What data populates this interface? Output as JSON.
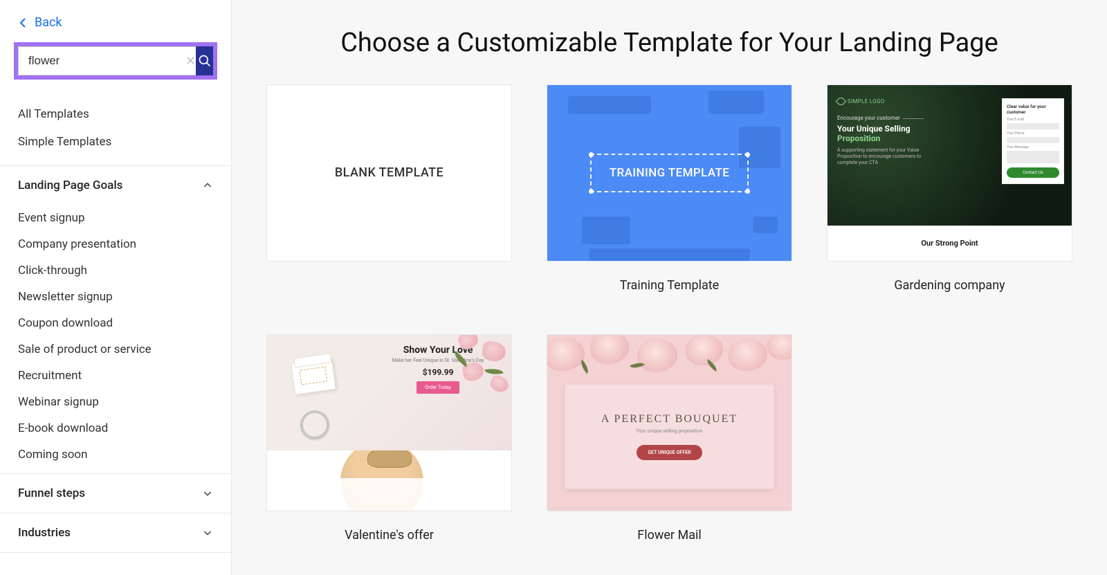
{
  "back_label": "Back",
  "search": {
    "value": "flower"
  },
  "nav": {
    "all_templates": "All Templates",
    "simple_templates": "Simple Templates"
  },
  "sections": {
    "goals": {
      "title": "Landing Page Goals",
      "items": [
        "Event signup",
        "Company presentation",
        "Click-through",
        "Newsletter signup",
        "Coupon download",
        "Sale of product or service",
        "Recruitment",
        "Webinar signup",
        "E-book download",
        "Coming soon"
      ]
    },
    "funnel": {
      "title": "Funnel steps"
    },
    "industries": {
      "title": "Industries"
    }
  },
  "page_title": "Choose a Customizable Template for Your Landing Page",
  "templates": {
    "blank": {
      "thumb_label": "BLANK TEMPLATE"
    },
    "training": {
      "thumb_label": "TRAINING TEMPLATE",
      "caption": "Training Template"
    },
    "gardening": {
      "caption": "Gardening company",
      "logo": "SIMPLE LOGO",
      "encourage": "Encourage your customer",
      "usp1": "Your Unique Selling",
      "usp2": "Proposition",
      "sub": "A supporting statement for your Value Proposition to encourage customers to complete your CTA",
      "form_title": "Clear value for your customer",
      "lbl_email": "Your E-mail",
      "lbl_phone": "Your Phone",
      "lbl_msg": "Your Message",
      "cta": "Contact Us",
      "strong_point": "Our Strong Point"
    },
    "valentine": {
      "caption": "Valentine's offer",
      "heading": "Show Your Love",
      "sub": "Make her Feel Unique in St. Valentine's Day",
      "price": "$199.99",
      "btn": "Order Today"
    },
    "flowermail": {
      "caption": "Flower Mail",
      "title": "A PERFECT BOUQUET",
      "sub": "Your unique selling proposition",
      "btn": "GET UNIQUE OFFER"
    }
  }
}
